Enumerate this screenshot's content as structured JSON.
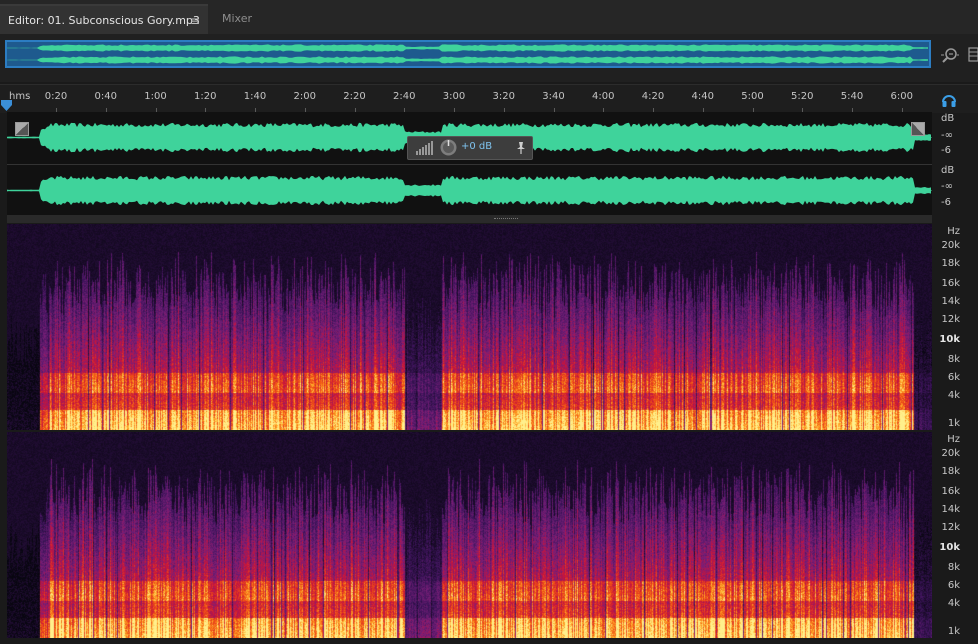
{
  "tabs": [
    {
      "label": "Editor: 01. Subconscious Gory.mp3"
    },
    {
      "label": "Mixer"
    }
  ],
  "tab_menu_icon": "≡",
  "ruler": {
    "unit": "hms",
    "ticks": [
      "0:20",
      "0:40",
      "1:00",
      "1:20",
      "1:40",
      "2:00",
      "2:20",
      "2:40",
      "3:00",
      "3:20",
      "3:40",
      "4:00",
      "4:20",
      "4:40",
      "5:00",
      "5:20",
      "5:40",
      "6:00"
    ]
  },
  "hud": {
    "gain": "+0 dB"
  },
  "amplitude_scale": [
    "dB",
    "-∞",
    "-6"
  ],
  "frequency_scale": [
    "Hz",
    "20k",
    "18k",
    "16k",
    "14k",
    "12k",
    "10k",
    "8k",
    "6k",
    "4k",
    "1k"
  ],
  "colors": {
    "waveform": "#3fd39b",
    "accent": "#2c7dc2",
    "hud_text": "#7fc3ef"
  },
  "icons": [
    "tab-menu-icon",
    "zoom-icon",
    "headphones-icon",
    "playhead-marker",
    "level-meter-icon",
    "gain-knob-icon",
    "pin-icon"
  ]
}
